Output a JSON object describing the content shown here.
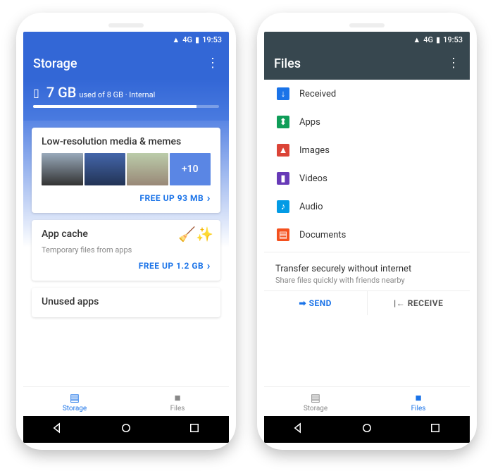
{
  "status": {
    "network": "4G",
    "time": "19:53"
  },
  "phone1": {
    "title": "Storage",
    "usage_value": "7 GB",
    "usage_suffix": "used of 8 GB · Internal",
    "card1": {
      "title": "Low-resolution media & memes",
      "more": "+10",
      "action": "FREE UP 93 MB"
    },
    "card2": {
      "title": "App cache",
      "sub": "Temporary files from apps",
      "action": "FREE UP 1.2 GB"
    },
    "card3": "Unused apps",
    "nav": {
      "storage": "Storage",
      "files": "Files"
    }
  },
  "phone2": {
    "title": "Files",
    "cats": {
      "received": "Received",
      "apps": "Apps",
      "images": "Images",
      "videos": "Videos",
      "audio": "Audio",
      "documents": "Documents"
    },
    "transfer": {
      "title": "Transfer securely without internet",
      "sub": "Share files quickly with friends nearby",
      "send": "SEND",
      "receive": "RECEIVE"
    },
    "nav": {
      "storage": "Storage",
      "files": "Files"
    }
  }
}
